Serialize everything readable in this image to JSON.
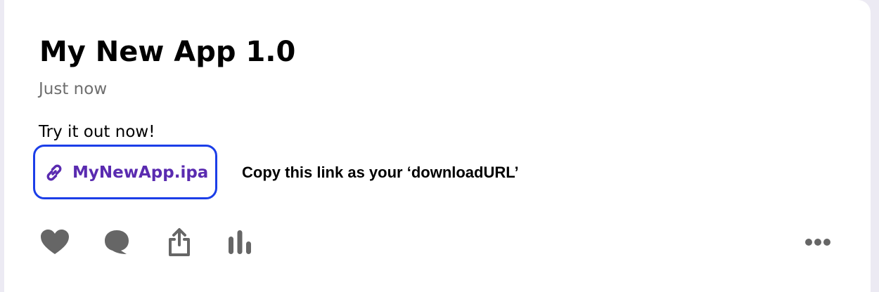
{
  "post": {
    "title": "My New App 1.0",
    "timestamp": "Just now",
    "body": "Try it out now!",
    "attachment": {
      "icon": "link-icon",
      "label": "MyNewApp.ipa"
    },
    "annotation": "Copy this link as your ‘downloadURL’"
  },
  "actions": [
    {
      "icon": "heart-icon"
    },
    {
      "icon": "comment-icon"
    },
    {
      "icon": "share-icon"
    },
    {
      "icon": "stats-icon"
    },
    {
      "icon": "more-icon"
    }
  ],
  "colors": {
    "background": "#eceaf3",
    "card": "#ffffff",
    "link_text": "#5a2bb0",
    "highlight_border": "#1b3ee8",
    "icon": "#666666",
    "secondary_text": "#6e6e6e"
  }
}
